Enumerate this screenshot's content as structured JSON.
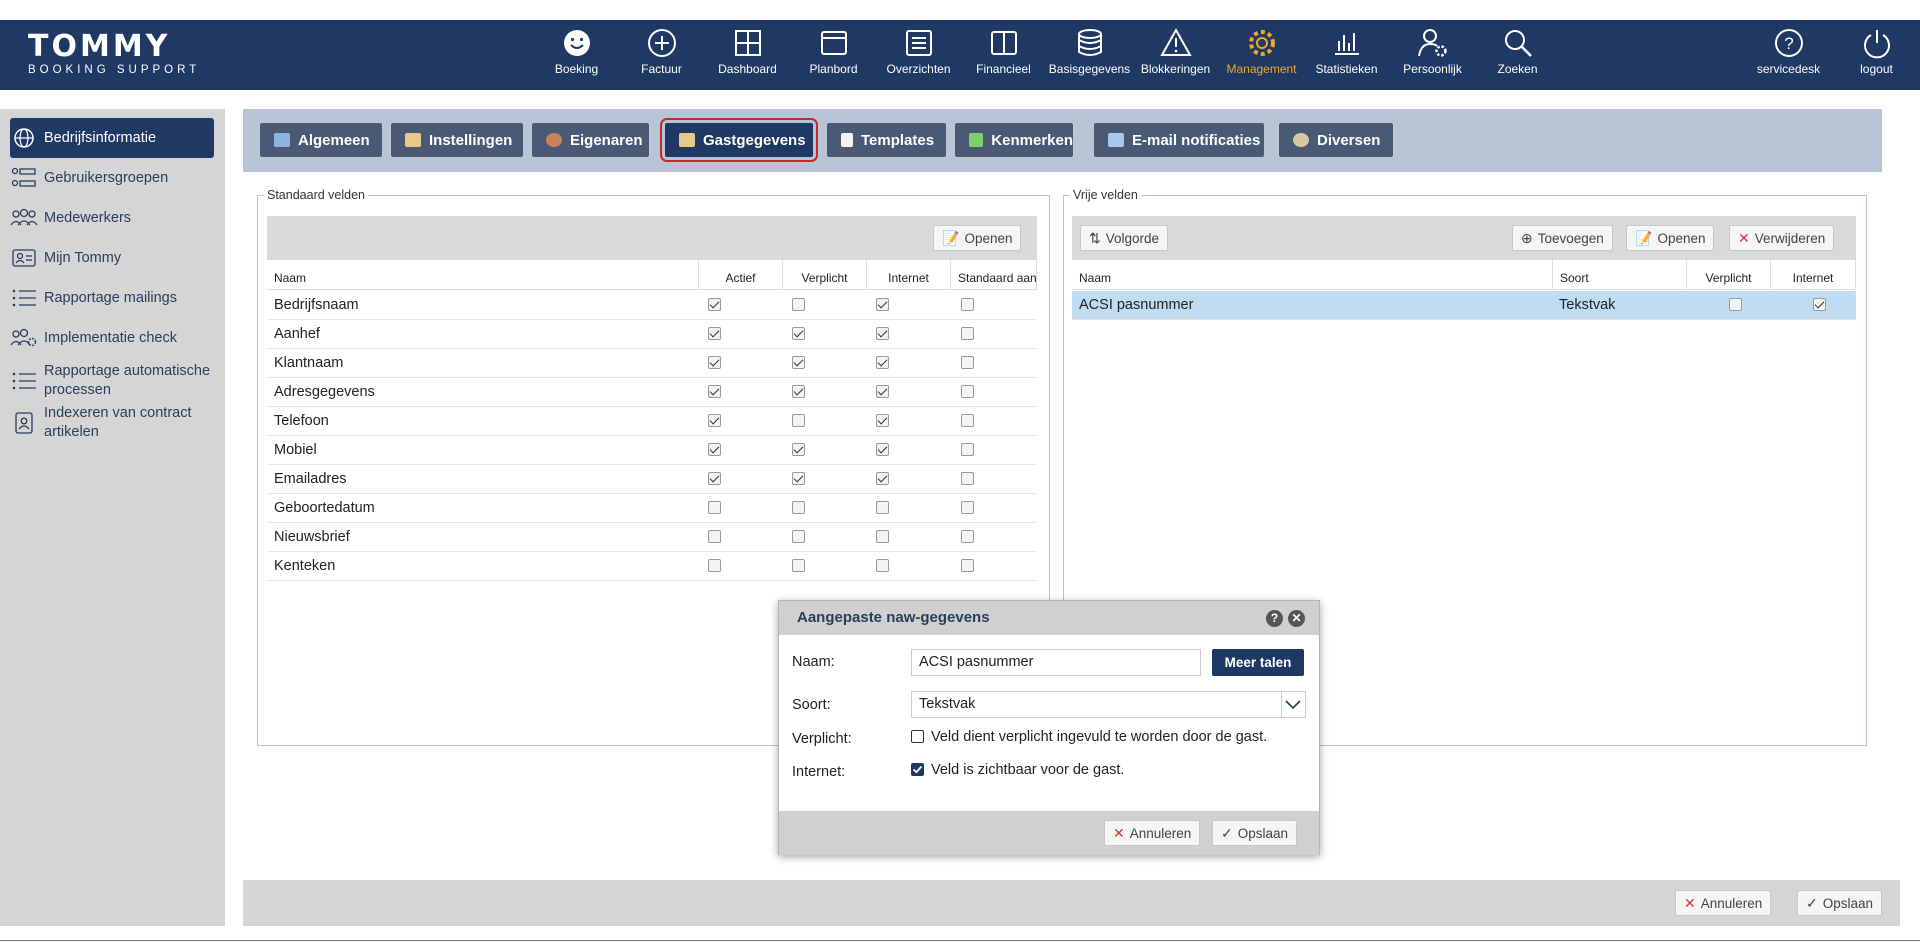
{
  "logo": {
    "title": "TOMMY",
    "subtitle": "BOOKING SUPPORT"
  },
  "nav": {
    "items": [
      {
        "label": "Boeking",
        "icon": "smiley-icon"
      },
      {
        "label": "Factuur",
        "icon": "plus-circle-icon"
      },
      {
        "label": "Dashboard",
        "icon": "grid-icon"
      },
      {
        "label": "Planbord",
        "icon": "window-icon"
      },
      {
        "label": "Overzichten",
        "icon": "list-icon"
      },
      {
        "label": "Financieel",
        "icon": "book-icon"
      },
      {
        "label": "Basisgegevens",
        "icon": "database-icon"
      },
      {
        "label": "Blokkeringen",
        "icon": "warning-icon"
      },
      {
        "label": "Management",
        "icon": "gear-icon"
      },
      {
        "label": "Statistieken",
        "icon": "bar-chart-icon"
      },
      {
        "label": "Persoonlijk",
        "icon": "user-gear-icon"
      },
      {
        "label": "Zoeken",
        "icon": "search-icon"
      }
    ],
    "active": "Management",
    "active_color": "#f5a623",
    "servicedesk": "servicedesk",
    "logout": "logout"
  },
  "sidebar": {
    "items": [
      {
        "label": "Bedrijfsinformatie",
        "icon": "globe-icon"
      },
      {
        "label": "Gebruikersgroepen",
        "icon": "groups-icon"
      },
      {
        "label": "Medewerkers",
        "icon": "people-icon"
      },
      {
        "label": "Mijn Tommy",
        "icon": "id-card-icon"
      },
      {
        "label": "Rapportage mailings",
        "icon": "list-icon"
      },
      {
        "label": "Implementatie check",
        "icon": "people-gear-icon"
      },
      {
        "label": "Rapportage automatische processen",
        "icon": "list-icon"
      },
      {
        "label": "Indexeren van contract artikelen",
        "icon": "contract-icon"
      }
    ]
  },
  "tabs": [
    {
      "label": "Algemeen"
    },
    {
      "label": "Instellingen"
    },
    {
      "label": "Eigenaren"
    },
    {
      "label": "Gastgegevens"
    },
    {
      "label": "Templates"
    },
    {
      "label": "Kenmerken"
    },
    {
      "label": "E-mail notificaties"
    },
    {
      "label": "Diversen"
    }
  ],
  "standard_fields": {
    "legend": "Standaard velden",
    "open_label": "Openen",
    "columns": [
      "Naam",
      "Actief",
      "Verplicht",
      "Internet",
      "Standaard aan"
    ],
    "rows": [
      {
        "name": "Bedrijfsnaam",
        "actief": true,
        "verplicht": false,
        "internet": true,
        "standaard": false
      },
      {
        "name": "Aanhef",
        "actief": true,
        "verplicht": true,
        "internet": true,
        "standaard": false
      },
      {
        "name": "Klantnaam",
        "actief": true,
        "verplicht": true,
        "internet": true,
        "standaard": false
      },
      {
        "name": "Adresgegevens",
        "actief": true,
        "verplicht": true,
        "internet": true,
        "standaard": false
      },
      {
        "name": "Telefoon",
        "actief": true,
        "verplicht": false,
        "internet": true,
        "standaard": false
      },
      {
        "name": "Mobiel",
        "actief": true,
        "verplicht": true,
        "internet": true,
        "standaard": false
      },
      {
        "name": "Emailadres",
        "actief": true,
        "verplicht": true,
        "internet": true,
        "standaard": false
      },
      {
        "name": "Geboortedatum",
        "actief": false,
        "verplicht": false,
        "internet": false,
        "standaard": false
      },
      {
        "name": "Nieuwsbrief",
        "actief": false,
        "verplicht": false,
        "internet": false,
        "standaard": false
      },
      {
        "name": "Kenteken",
        "actief": false,
        "verplicht": false,
        "internet": false,
        "standaard": false
      }
    ]
  },
  "free_fields": {
    "legend": "Vrije velden",
    "order_label": "Volgorde",
    "add_label": "Toevoegen",
    "open_label": "Openen",
    "delete_label": "Verwijderen",
    "columns": [
      "Naam",
      "Soort",
      "Verplicht",
      "Internet"
    ],
    "rows": [
      {
        "name": "ACSI pasnummer",
        "soort": "Tekstvak",
        "verplicht": false,
        "internet": true
      }
    ]
  },
  "dialog": {
    "title": "Aangepaste naw-gegevens",
    "name_label": "Naam:",
    "name_value": "ACSI pasnummer",
    "more_languages": "Meer talen",
    "type_label": "Soort:",
    "type_value": "Tekstvak",
    "required_label": "Verplicht:",
    "required_text": "Veld dient verplicht ingevuld te worden door de gast.",
    "required_checked": false,
    "internet_label": "Internet:",
    "internet_text": "Veld is zichtbaar voor de gast.",
    "internet_checked": true,
    "cancel": "Annuleren",
    "save": "Opslaan"
  },
  "footer": {
    "cancel": "Annuleren",
    "save": "Opslaan"
  }
}
